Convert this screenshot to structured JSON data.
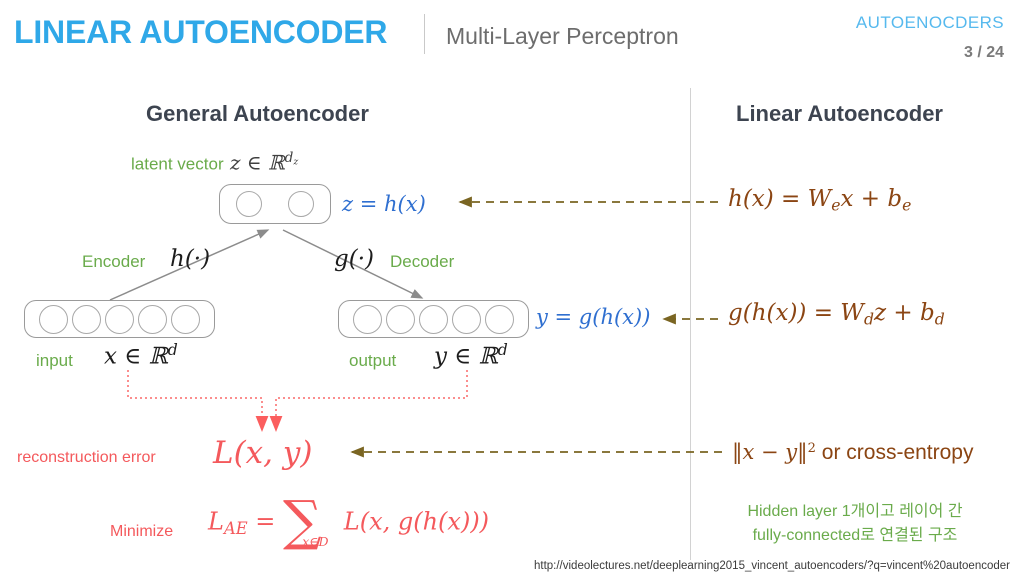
{
  "header": {
    "title": "LINEAR AUTOENCODER",
    "subtitle": "Multi-Layer Perceptron",
    "deck_name": "AUTOENOCDERS",
    "slide_number": "3 / 24",
    "accent_color": "#2fa8e8"
  },
  "columns": {
    "left_heading": "General Autoencoder",
    "right_heading": "Linear Autoencoder"
  },
  "diagram": {
    "latent_vector_label": "latent vector",
    "latent_vector_math": "z ∈ ℝ",
    "latent_vector_sup": "d",
    "latent_vector_sup_sub": "z",
    "latent_neuron_count": 2,
    "input_neuron_count": 5,
    "output_neuron_count": 5,
    "encoder_label": "Encoder",
    "encoder_math": "h(·)",
    "decoder_label": "Decoder",
    "decoder_math": "g(·)",
    "input_label": "input",
    "input_math": "x ∈ ℝ",
    "input_math_sup": "d",
    "output_label": "output",
    "output_math": "y ∈ ℝ",
    "output_math_sup": "d",
    "latent_equation": "z = h(x)",
    "output_equation": "y = g(h(x))",
    "equation_color": "#2f6fd0"
  },
  "loss": {
    "reconstruction_label": "reconstruction error",
    "reconstruction_math": "L(x, y)",
    "minimize_label": "Minimize",
    "minimize_lhs": "L",
    "minimize_lhs_sub": "AE",
    "minimize_eq": "=",
    "minimize_sum": "∑",
    "minimize_sum_sub": "x∈D",
    "minimize_rhs": "L(x, g(h(x)))",
    "color": "#f4595c"
  },
  "linear": {
    "encoder_formula_lhs": "h(x) = W",
    "encoder_formula_sub": "e",
    "encoder_formula_mid": "x + b",
    "encoder_formula_sub2": "e",
    "decoder_formula_lhs": "g(h(x)) = W",
    "decoder_formula_sub": "d",
    "decoder_formula_mid": "z + b",
    "decoder_formula_sub2": "d",
    "loss_formula_math": "‖x − y‖",
    "loss_formula_sup": "2",
    "loss_formula_text": " or cross-entropy",
    "color": "#8b4513"
  },
  "note": {
    "line1": "Hidden layer 1개이고 레이어 간",
    "line2": "fully-connected로 연결된 구조",
    "color": "#6aab4b"
  },
  "footer": {
    "source_url": "http://videolectures.net/deeplearning2015_vincent_autoencoders/?q=vincent%20autoencoder"
  }
}
